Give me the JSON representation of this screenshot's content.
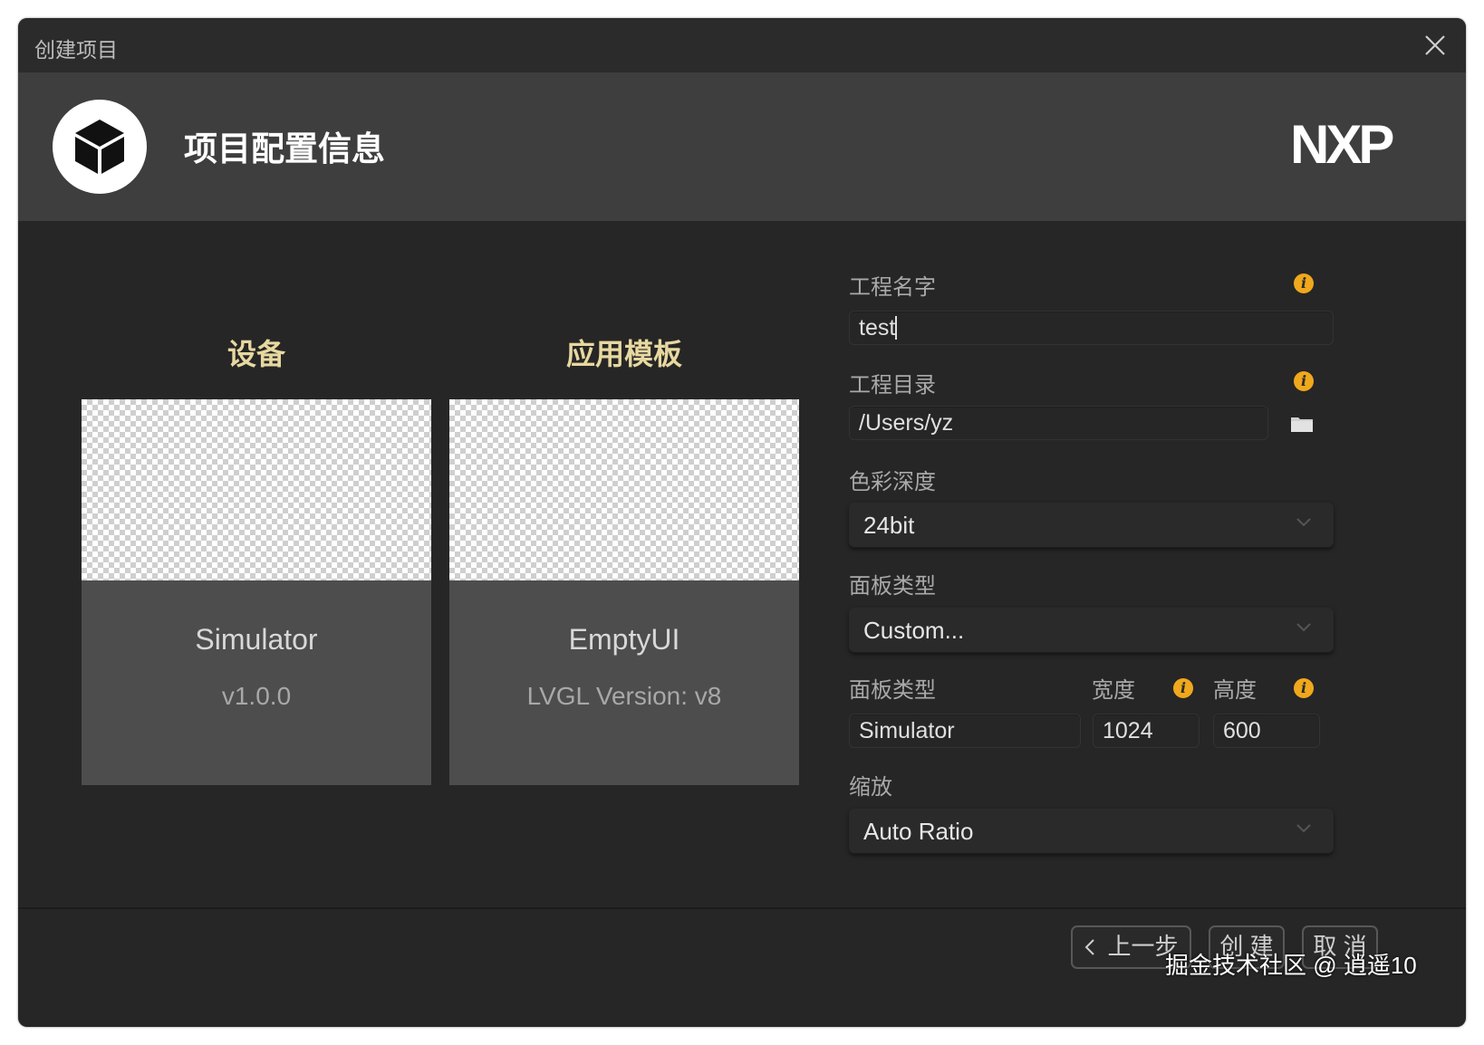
{
  "window": {
    "title": "创建项目",
    "heading": "项目配置信息",
    "brand": "NXP"
  },
  "cards": [
    {
      "title": "设备",
      "name": "Simulator",
      "sub": "v1.0.0"
    },
    {
      "title": "应用模板",
      "name": "EmptyUI",
      "sub": "LVGL Version: v8"
    }
  ],
  "form": {
    "project_name_label": "工程名字",
    "project_name_value": "test",
    "project_dir_label": "工程目录",
    "project_dir_value": "/Users/yz",
    "color_depth_label": "色彩深度",
    "color_depth_value": "24bit",
    "panel_type_label": "面板类型",
    "panel_type_value": "Custom...",
    "panel_type_label2": "面板类型",
    "width_label": "宽度",
    "height_label": "高度",
    "panel_name_value": "Simulator",
    "width_value": "1024",
    "height_value": "600",
    "scale_label": "缩放",
    "scale_value": "Auto Ratio",
    "info_glyph": "i"
  },
  "footer": {
    "prev_label": "上一步",
    "create_label": "创 建",
    "cancel_label": "取 消"
  },
  "watermark": "掘金技术社区 @ 逍遥10",
  "colors": {
    "window_bg": "#262626",
    "header_bg": "#3d3e3d",
    "card_title": "#e7d8a0",
    "info_badge": "#f0a81c"
  },
  "icons": {
    "close": "close-icon",
    "logo": "cube-icon",
    "folder": "folder-icon",
    "chevron": "chevron-down-icon",
    "back": "chevron-left-icon",
    "info": "info-icon"
  }
}
